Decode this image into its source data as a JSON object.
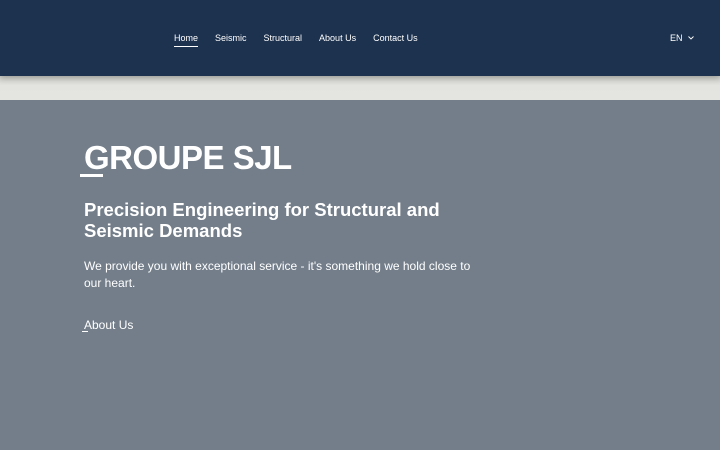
{
  "header": {
    "nav": [
      {
        "label": "Home",
        "active": true
      },
      {
        "label": "Seismic",
        "active": false
      },
      {
        "label": "Structural",
        "active": false
      },
      {
        "label": "About Us",
        "active": false
      },
      {
        "label": "Contact Us",
        "active": false
      }
    ],
    "language": "EN"
  },
  "hero": {
    "brand": "GROUPE SJL",
    "headline": "Precision Engineering for Structural and Seismic Demands",
    "subtext": "We provide you with exceptional service - it's something we hold close to our heart.",
    "cta_label": "About Us"
  },
  "colors": {
    "header_bg": "#1d324f",
    "hero_bg": "#737e8a",
    "band_bg": "#e3e3df",
    "text": "#ffffff"
  },
  "icons": {
    "language": "chevron-down-icon"
  }
}
